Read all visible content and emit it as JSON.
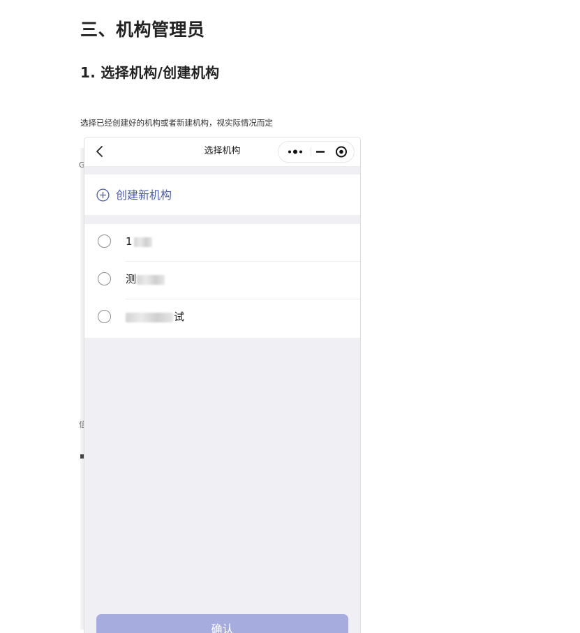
{
  "document": {
    "section_heading": "三、机构管理员",
    "subheading": "1. 选择机构/创建机构",
    "description": "选择已经创建好的机构或者新建机构，视实际情况而定",
    "edge_fragments": [
      "G",
      "信"
    ]
  },
  "phone": {
    "nav": {
      "back_icon": "chevron-left-icon",
      "title": "选择机构",
      "capsule_icons": [
        "more-dots-icon",
        "minimize-icon",
        "close-circle-icon"
      ]
    },
    "create": {
      "icon": "plus-circle-icon",
      "label": "创建新机构"
    },
    "organizations": [
      {
        "visible_text": "1",
        "selected": false
      },
      {
        "visible_text": "测",
        "selected": false
      },
      {
        "visible_text": "试",
        "selected": false
      }
    ],
    "confirm_label": "确认"
  },
  "colors": {
    "accent": "#4a5cb3",
    "confirm_button": "#a7acdf",
    "page_background": "#f0eff4"
  }
}
